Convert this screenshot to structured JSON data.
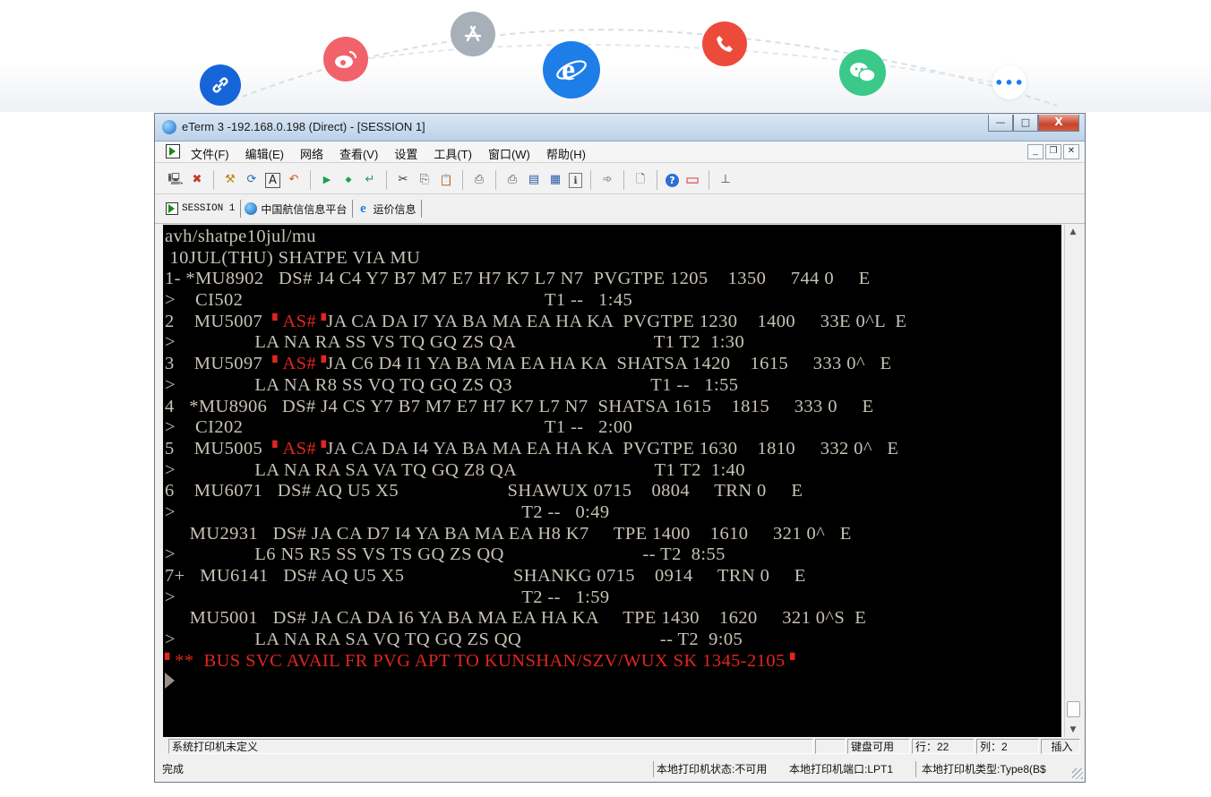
{
  "colors": {
    "terminal_bg": "#000000",
    "terminal_text": "#c8c2b6",
    "terminal_alert": "#e0261d",
    "titlebar": "#bcd2ea"
  },
  "top_icons": [
    {
      "name": "link-icon",
      "color": "#1565d8"
    },
    {
      "name": "weibo-icon",
      "color": "#f2626a"
    },
    {
      "name": "app-store-icon",
      "color": "#a7b0b9"
    },
    {
      "name": "internet-explorer-icon",
      "color": "#1e7ee8"
    },
    {
      "name": "phone-icon",
      "color": "#ec4b3c"
    },
    {
      "name": "wechat-icon",
      "color": "#3bc98a"
    },
    {
      "name": "more-icon",
      "color": "#ffffff"
    }
  ],
  "window": {
    "title": "eTerm 3 -192.168.0.198 (Direct) - [SESSION 1]",
    "controls": {
      "minimize": "—",
      "maximize": "□",
      "close": "X"
    }
  },
  "menu": {
    "items": [
      "文件(F)",
      "编辑(E)",
      "网络",
      "查看(V)",
      "设置",
      "工具(T)",
      "窗口(W)",
      "帮助(H)"
    ],
    "mdi_controls": {
      "minimize": "_",
      "restore": "❐",
      "close": "✕"
    }
  },
  "toolbar": {
    "buttons": [
      {
        "icon": "connect-icon",
        "glyph": "🖳"
      },
      {
        "icon": "disconnect-icon",
        "glyph": "✖"
      },
      {
        "icon": "tools-icon",
        "glyph": "⚒"
      },
      {
        "icon": "refresh-icon",
        "glyph": "⟳"
      },
      {
        "icon": "text-mode-icon",
        "glyph": "A"
      },
      {
        "icon": "undo-icon",
        "glyph": "↶"
      },
      {
        "icon": "play-icon",
        "glyph": "▶"
      },
      {
        "icon": "step-icon",
        "glyph": "◆"
      },
      {
        "icon": "enter-icon",
        "glyph": "↵"
      },
      {
        "icon": "cut-icon",
        "glyph": "✂"
      },
      {
        "icon": "copy-icon",
        "glyph": "⎘"
      },
      {
        "icon": "paste-icon",
        "glyph": "📋"
      },
      {
        "icon": "print-icon",
        "glyph": "⎙"
      },
      {
        "icon": "print-setup-icon",
        "glyph": "⎙"
      },
      {
        "icon": "book-icon",
        "glyph": "▤"
      },
      {
        "icon": "list-icon",
        "glyph": "▦"
      },
      {
        "icon": "info-icon",
        "glyph": "ℹ"
      },
      {
        "icon": "send-icon",
        "glyph": "➾"
      },
      {
        "icon": "new-document-icon",
        "glyph": "🗋"
      },
      {
        "icon": "help-icon",
        "glyph": "?"
      },
      {
        "icon": "log-icon",
        "glyph": "▭"
      },
      {
        "icon": "stamp-icon",
        "glyph": "⊥"
      }
    ]
  },
  "tabs": [
    {
      "label": "SESSION 1",
      "icon": "session-icon"
    },
    {
      "label": "中国航信信息平台",
      "icon": "globe-icon"
    },
    {
      "label": "运价信息",
      "icon": "internet-explorer-icon"
    }
  ],
  "terminal": {
    "lines": [
      {
        "type": "plain",
        "text": "avh/shatpe10jul/mu"
      },
      {
        "type": "plain",
        "text": " 10JUL(THU) SHATPE VIA MU"
      },
      {
        "type": "plain",
        "text": "1- *MU8902   DS# J4 C4 Y7 B7 M7 E7 H7 K7 L7 N7  PVGTPE 1205    1350     744 0     E"
      },
      {
        "type": "plain",
        "text": ">    CI502                                                             T1 --   1:45"
      },
      {
        "type": "as",
        "pre": "2    MU5007  ",
        "code": "AS#",
        "post": "JA CA DA I7 YA BA MA EA HA KA  PVGTPE 1230    1400     33E 0^L  E"
      },
      {
        "type": "plain",
        "text": ">                LA NA RA SS VS TQ GQ ZS QA                            T1 T2  1:30"
      },
      {
        "type": "as",
        "pre": "3    MU5097  ",
        "code": "AS#",
        "post": "JA C6 D4 I1 YA BA MA EA HA KA  SHATSA 1420    1615     333 0^   E"
      },
      {
        "type": "plain",
        "text": ">                LA NA R8 SS VQ TQ GQ ZS Q3                            T1 --   1:55"
      },
      {
        "type": "plain",
        "text": "4   *MU8906   DS# J4 CS Y7 B7 M7 E7 H7 K7 L7 N7  SHATSA 1615    1815     333 0     E"
      },
      {
        "type": "plain",
        "text": ">    CI202                                                             T1 --   2:00"
      },
      {
        "type": "as",
        "pre": "5    MU5005  ",
        "code": "AS#",
        "post": "JA CA DA I4 YA BA MA EA HA KA  PVGTPE 1630    1810     332 0^   E"
      },
      {
        "type": "plain",
        "text": ">                LA NA RA SA VA TQ GQ Z8 QA                            T1 T2  1:40"
      },
      {
        "type": "plain",
        "text": "6    MU6071   DS# AQ U5 X5                      SHAWUX 0715    0804     TRN 0     E"
      },
      {
        "type": "plain",
        "text": ">                                                                      T2 --   0:49"
      },
      {
        "type": "plain",
        "text": "     MU2931   DS# JA CA D7 I4 YA BA MA EA H8 K7     TPE 1400    1610     321 0^   E"
      },
      {
        "type": "plain",
        "text": ">                L6 N5 R5 SS VS TS GQ ZS QQ                            -- T2  8:55"
      },
      {
        "type": "plain",
        "text": "7+   MU6141   DS# AQ U5 X5                      SHANKG 0715    0914     TRN 0     E"
      },
      {
        "type": "plain",
        "text": ">                                                                      T2 --   1:59"
      },
      {
        "type": "plain",
        "text": "     MU5001   DS# JA CA DA I6 YA BA MA EA HA KA     TPE 1430    1620     321 0^S  E"
      },
      {
        "type": "plain",
        "text": ">                LA NA RA SA VQ TQ GQ ZS QQ                            -- T2  9:05"
      },
      {
        "type": "alert",
        "text": "**  BUS SVC AVAIL FR PVG APT TO KUNSHAN/SZV/WUX SK 1345-2105"
      }
    ]
  },
  "status_bar": {
    "printer": "系统打印机未定义",
    "keyboard": "键盘可用",
    "row": "行：22",
    "col": "列：2",
    "insert": "插入"
  },
  "bottom_status": {
    "state": "完成",
    "local_printer_status": "本地打印机状态:不可用",
    "local_printer_port": "本地打印机端口:LPT1",
    "local_printer_type": "本地打印机类型:Type8(B$"
  }
}
